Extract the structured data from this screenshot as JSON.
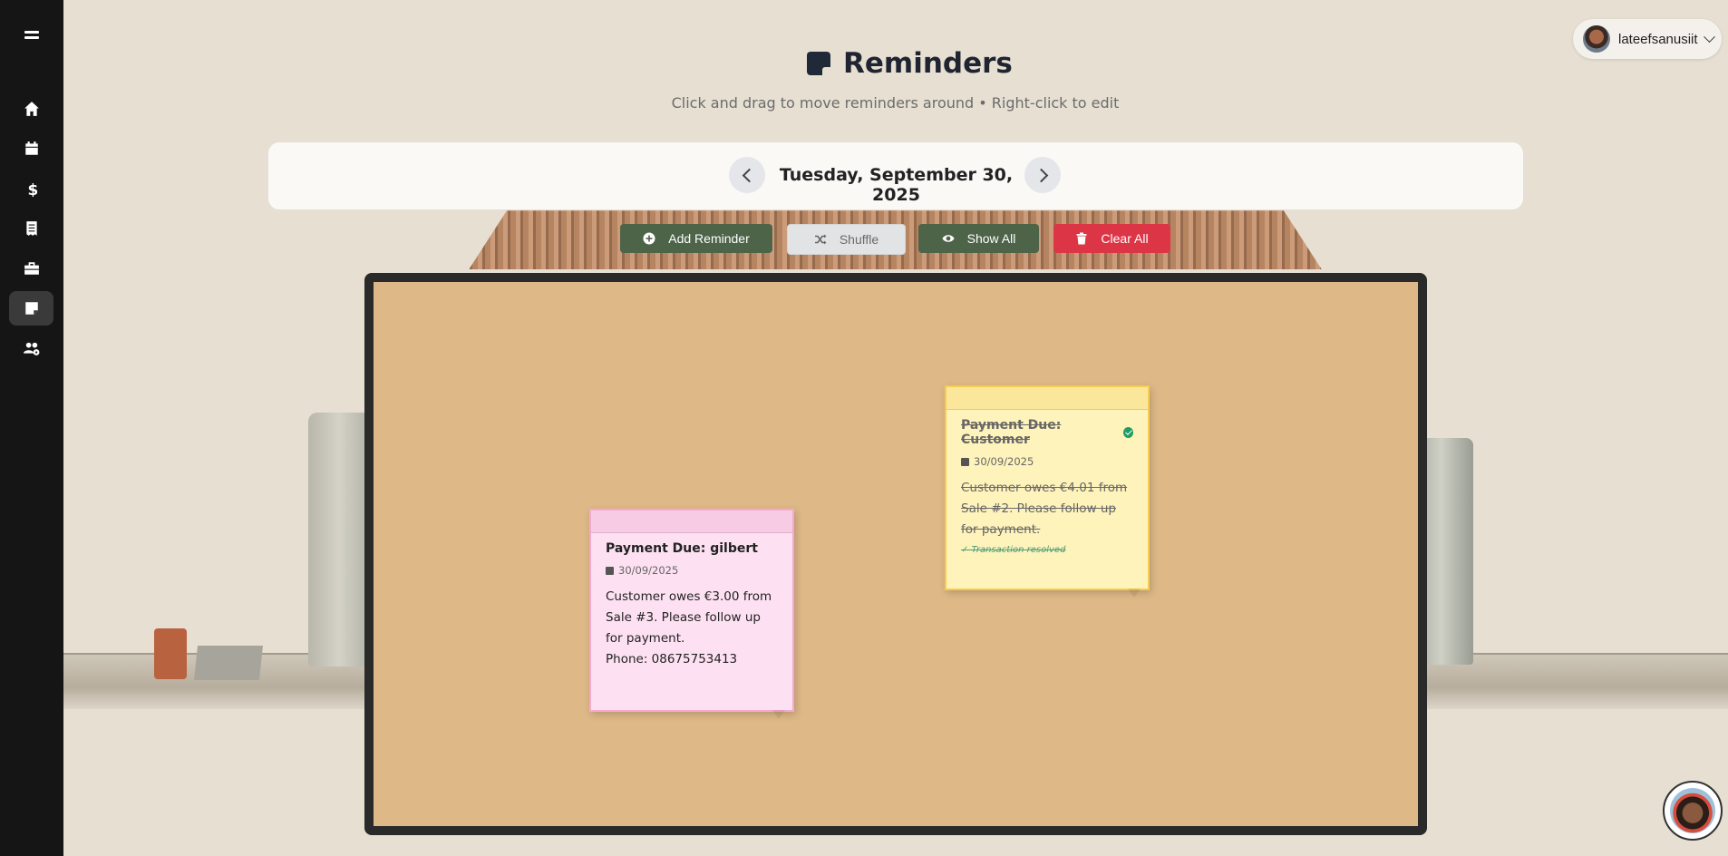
{
  "app": {
    "title": "Reminders",
    "subtitle": "Click and drag to move reminders around • Right-click to edit"
  },
  "sidebar": {
    "items": [
      {
        "icon": "home-icon"
      },
      {
        "icon": "calendar-icon"
      },
      {
        "icon": "dollar-icon"
      },
      {
        "icon": "receipt-icon"
      },
      {
        "icon": "briefcase-icon"
      },
      {
        "icon": "sticky-note-icon",
        "active": true
      },
      {
        "icon": "users-cog-icon"
      }
    ]
  },
  "user": {
    "name": "lateefsanusiit"
  },
  "datebar": {
    "date": "Tuesday, September 30, 2025"
  },
  "actions": {
    "add": "Add Reminder",
    "shuffle": "Shuffle",
    "show_all": "Show All",
    "clear_all": "Clear All"
  },
  "notes": [
    {
      "title": "Payment Due: gilbert",
      "date": "30/09/2025",
      "text": "Customer owes €3.00 from Sale #3. Please follow up for payment.",
      "phone": "Phone: 08675753413",
      "color": "#fde1f2",
      "resolved": false
    },
    {
      "title": "Payment Due: Customer",
      "date": "30/09/2025",
      "text": "Customer owes €4.01 from Sale #2. Please follow up for payment.",
      "status": "✓ Transaction resolved",
      "color": "#fff3bc",
      "resolved": true
    }
  ],
  "colors": {
    "sidebar": "#151515",
    "primary": "#4d6449",
    "danger": "#dc3545",
    "board": "#deb887"
  }
}
